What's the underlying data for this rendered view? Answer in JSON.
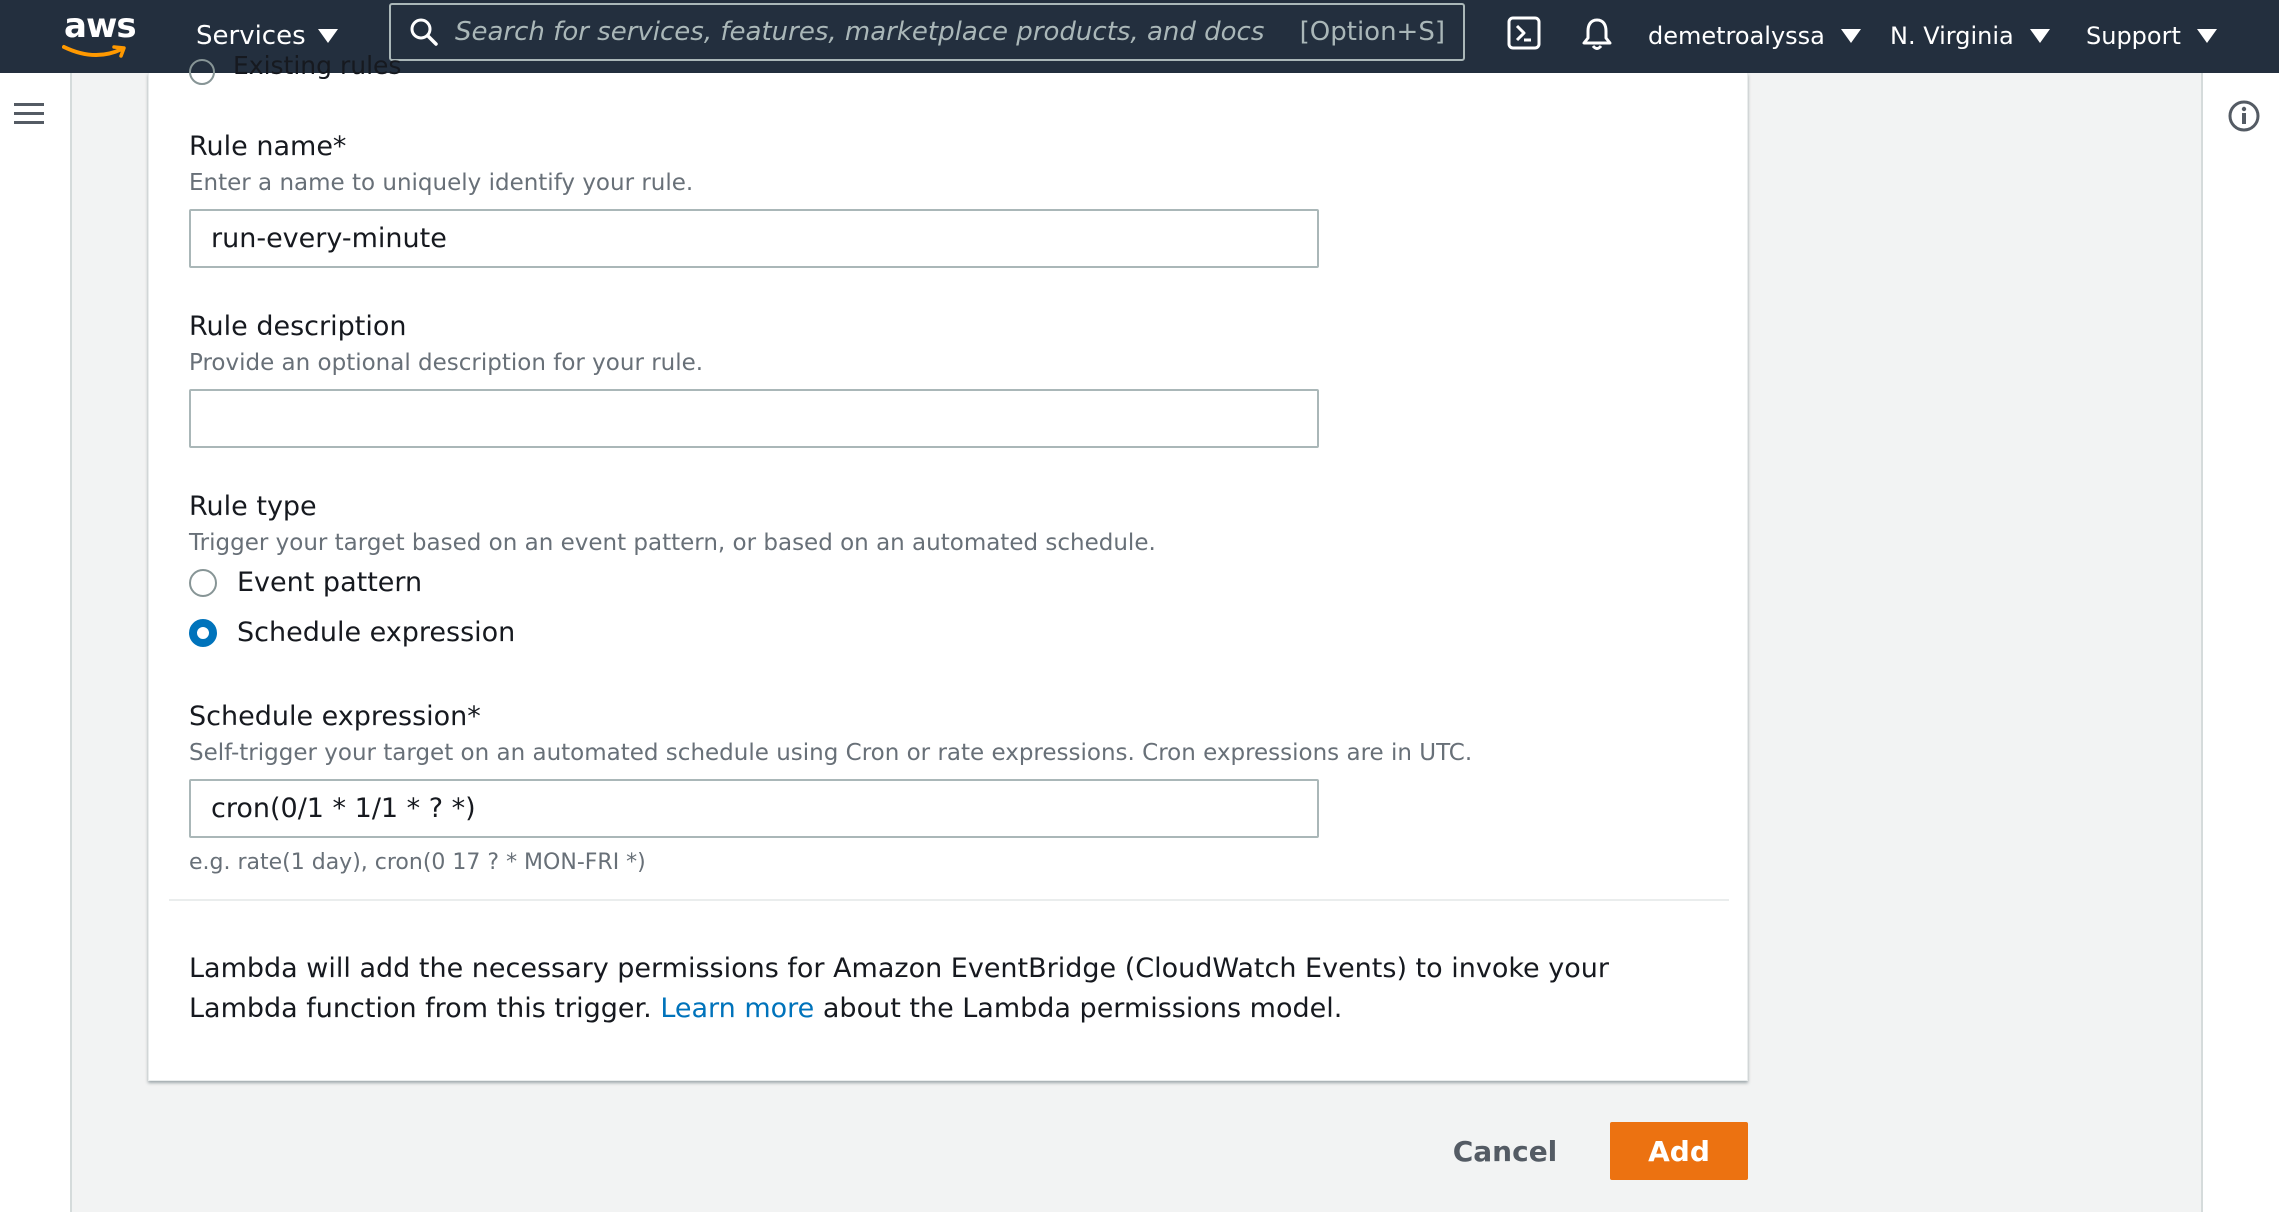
{
  "topnav": {
    "logo_text": "aws",
    "services_label": "Services",
    "search": {
      "placeholder": "Search for services, features, marketplace products, and docs",
      "shortcut": "[Option+S]"
    },
    "account": "demetroalyssa",
    "region": "N. Virginia",
    "support": "Support"
  },
  "form": {
    "previous_option_label": "Existing rules",
    "rule_name": {
      "label": "Rule name*",
      "description": "Enter a name to uniquely identify your rule.",
      "value": "run-every-minute"
    },
    "rule_description": {
      "label": "Rule description",
      "description": "Provide an optional description for your rule.",
      "value": ""
    },
    "rule_type": {
      "label": "Rule type",
      "description": "Trigger your target based on an event pattern, or based on an automated schedule.",
      "options": [
        {
          "label": "Event pattern",
          "selected": false
        },
        {
          "label": "Schedule expression",
          "selected": true
        }
      ]
    },
    "schedule_expression": {
      "label": "Schedule expression*",
      "description": "Self-trigger your target on an automated schedule using Cron or rate expressions. Cron expressions are in UTC.",
      "value": "cron(0/1 * 1/1 * ? *)",
      "hint": "e.g. rate(1 day), cron(0 17 ? * MON-FRI *)"
    },
    "permissions_note": {
      "text_before": "Lambda will add the necessary permissions for Amazon EventBridge (CloudWatch Events) to invoke your Lambda function from this trigger.",
      "link": "Learn more",
      "text_after": "about the Lambda permissions model."
    }
  },
  "footer": {
    "cancel_label": "Cancel",
    "add_label": "Add"
  },
  "colors": {
    "nav_bg": "#232f3e",
    "accent_orange": "#ec7211",
    "link_blue": "#0073bb",
    "page_bg": "#f2f3f3"
  }
}
